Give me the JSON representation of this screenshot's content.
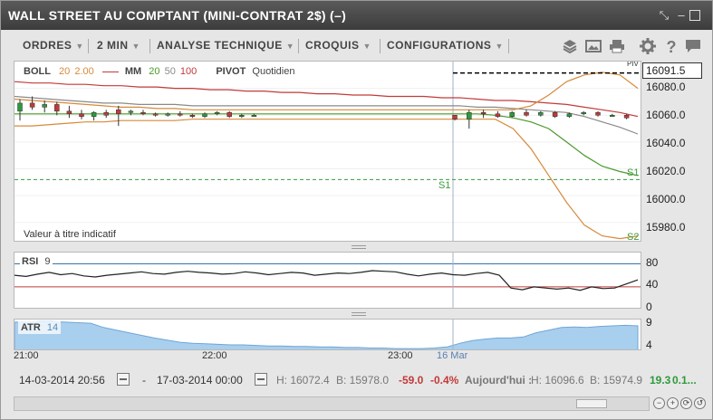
{
  "window": {
    "title": "WALL STREET AU COMPTANT (MINI-CONTRAT 2$) (–)",
    "controls": [
      "collapse-icon",
      "restore-icon",
      "maximize-icon",
      "close-icon"
    ]
  },
  "toolbar": {
    "menus": [
      {
        "label": "ORDRES"
      },
      {
        "label": "2 MIN"
      },
      {
        "label": "ANALYSE TECHNIQUE"
      },
      {
        "label": "CROQUIS"
      },
      {
        "label": "CONFIGURATIONS"
      }
    ],
    "icons": [
      "layers-icon",
      "image-icon",
      "print-icon",
      "gear-icon",
      "help-icon",
      "chat-icon"
    ]
  },
  "main_panel": {
    "legend": {
      "boll_label": "BOLL",
      "boll_p1": "20",
      "boll_p2": "2.00",
      "mm_label": "MM",
      "mm_p1": "20",
      "mm_p2": "50",
      "mm_p3": "100",
      "pivot_label": "PIVOT",
      "pivot_value": "Quotidien"
    },
    "indicative_note": "Valeur à titre indicatif",
    "current_price": "16091.5",
    "price_tag_marker": "PIV",
    "s1_label_left": "S1",
    "s1_label_right": "S1",
    "s2_label": "S2"
  },
  "rsi_panel": {
    "label": "RSI",
    "period": "9"
  },
  "atr_panel": {
    "label": "ATR",
    "period": "14"
  },
  "colors": {
    "boll": "#d7893a",
    "mm20": "#4a9a2a",
    "mm50": "#8a8a8a",
    "mm100": "#c23a3a",
    "up": "#2e9a3c",
    "down": "#c23a3a",
    "atr_fill": "#a9cfee",
    "pivot": "#3a9a3a"
  },
  "chart_data": [
    {
      "type": "line",
      "title": "WALL STREET AU COMPTANT (MINI-CONTRAT 2$)",
      "ylim": [
        15965,
        16100
      ],
      "yticks": [
        15980,
        16000,
        16020,
        16040,
        16060,
        16080
      ],
      "xticks": [
        "21:00",
        "22:00",
        "23:00",
        "16 Mar"
      ],
      "current_value": 16091.5,
      "pivot_lines": [
        {
          "name": "S1",
          "value": 16012
        },
        {
          "name": "S2",
          "value": 15963
        }
      ],
      "candles": [
        {
          "o": 16063,
          "h": 16072,
          "l": 16056,
          "c": 16069
        },
        {
          "o": 16069,
          "h": 16074,
          "l": 16064,
          "c": 16066
        },
        {
          "o": 16066,
          "h": 16071,
          "l": 16062,
          "c": 16068
        },
        {
          "o": 16068,
          "h": 16070,
          "l": 16060,
          "c": 16063
        },
        {
          "o": 16063,
          "h": 16067,
          "l": 16058,
          "c": 16061
        },
        {
          "o": 16061,
          "h": 16064,
          "l": 16057,
          "c": 16059
        },
        {
          "o": 16059,
          "h": 16063,
          "l": 16056,
          "c": 16062
        },
        {
          "o": 16062,
          "h": 16064,
          "l": 16058,
          "c": 16060
        },
        {
          "o": 16064,
          "h": 16067,
          "l": 16052,
          "c": 16061
        },
        {
          "o": 16062,
          "h": 16064,
          "l": 16060,
          "c": 16063
        },
        {
          "o": 16062,
          "h": 16064,
          "l": 16060,
          "c": 16061
        },
        {
          "o": 16061,
          "h": 16062,
          "l": 16059,
          "c": 16060
        },
        {
          "o": 16060,
          "h": 16062,
          "l": 16059,
          "c": 16061
        },
        {
          "o": 16061,
          "h": 16063,
          "l": 16059,
          "c": 16060
        },
        {
          "o": 16060,
          "h": 16061,
          "l": 16058,
          "c": 16059
        },
        {
          "o": 16059,
          "h": 16062,
          "l": 16058,
          "c": 16061
        },
        {
          "o": 16061,
          "h": 16063,
          "l": 16060,
          "c": 16062
        },
        {
          "o": 16062,
          "h": 16063,
          "l": 16058,
          "c": 16059
        },
        {
          "o": 16059,
          "h": 16061,
          "l": 16058,
          "c": 16060
        },
        {
          "o": 16060,
          "h": 16061,
          "l": 16059,
          "c": 16060
        },
        {
          "o": 16060,
          "h": 16060,
          "l": 16056,
          "c": 16057
        },
        {
          "o": 16057,
          "h": 16064,
          "l": 16050,
          "c": 16062
        },
        {
          "o": 16062,
          "h": 16064,
          "l": 16058,
          "c": 16061
        },
        {
          "o": 16061,
          "h": 16063,
          "l": 16058,
          "c": 16059
        },
        {
          "o": 16059,
          "h": 16063,
          "l": 16058,
          "c": 16062
        },
        {
          "o": 16062,
          "h": 16064,
          "l": 16059,
          "c": 16060
        },
        {
          "o": 16060,
          "h": 16063,
          "l": 16059,
          "c": 16062
        },
        {
          "o": 16062,
          "h": 16063,
          "l": 16058,
          "c": 16059
        },
        {
          "o": 16059,
          "h": 16062,
          "l": 16058,
          "c": 16061
        },
        {
          "o": 16061,
          "h": 16063,
          "l": 16060,
          "c": 16062
        },
        {
          "o": 16062,
          "h": 16063,
          "l": 16059,
          "c": 16060
        },
        {
          "o": 16060,
          "h": 16061,
          "l": 16059,
          "c": 16060
        },
        {
          "o": 16060,
          "h": 16061,
          "l": 16057,
          "c": 16058
        }
      ],
      "ma20": [
        16061,
        16061,
        16061,
        16061,
        16061,
        16061,
        16061,
        16061,
        16061,
        16061,
        16061,
        16061,
        16061,
        16061,
        16061,
        16061,
        16061,
        16061,
        16061,
        16061,
        16061,
        16061,
        16061,
        16061,
        16061,
        16061,
        16061,
        16060,
        16058,
        16055,
        16050,
        16040,
        16030,
        16022,
        16018,
        16015
      ],
      "ma50": [
        16074,
        16073,
        16072,
        16071,
        16070,
        16069,
        16069,
        16068,
        16068,
        16068,
        16067,
        16067,
        16067,
        16067,
        16067,
        16067,
        16067,
        16067,
        16067,
        16067,
        16067,
        16067,
        16067,
        16067,
        16067,
        16067,
        16066,
        16066,
        16065,
        16064,
        16063,
        16062,
        16059,
        16055,
        16051,
        16046
      ],
      "ma100": [
        16085,
        16084,
        16084,
        16083,
        16083,
        16082,
        16082,
        16081,
        16081,
        16080,
        16080,
        16079,
        16079,
        16078,
        16078,
        16077,
        16077,
        16076,
        16076,
        16075,
        16075,
        16074,
        16074,
        16074,
        16073,
        16073,
        16072,
        16071,
        16071,
        16070,
        16069,
        16068,
        16066,
        16064,
        16062,
        16059
      ],
      "boll_upper": [
        16072,
        16071,
        16070,
        16069,
        16068,
        16067,
        16066,
        16066,
        16065,
        16065,
        16064,
        16064,
        16064,
        16064,
        16064,
        16064,
        16064,
        16064,
        16064,
        16064,
        16064,
        16064,
        16064,
        16064,
        16064,
        16064,
        16064,
        16064,
        16064,
        16067,
        16075,
        16085,
        16090,
        16092,
        16090,
        16080
      ],
      "boll_lower": [
        16052,
        16052,
        16053,
        16054,
        16055,
        16055,
        16056,
        16056,
        16056,
        16056,
        16057,
        16057,
        16057,
        16057,
        16057,
        16057,
        16057,
        16057,
        16057,
        16057,
        16057,
        16057,
        16057,
        16057,
        16057,
        16057,
        16057,
        16057,
        16050,
        16035,
        16015,
        15995,
        15978,
        15970,
        15968,
        15970
      ]
    },
    {
      "type": "line",
      "title": "RSI 9",
      "ylim": [
        0,
        80
      ],
      "yticks": [
        0,
        40,
        80
      ],
      "levels": [
        30,
        70
      ],
      "values": [
        50,
        48,
        52,
        55,
        51,
        53,
        49,
        47,
        50,
        52,
        54,
        56,
        53,
        52,
        55,
        57,
        55,
        54,
        52,
        53,
        56,
        54,
        51,
        53,
        55,
        54,
        50,
        52,
        54,
        53,
        55,
        58,
        57,
        56,
        52,
        49,
        52,
        54,
        51,
        50,
        53,
        55,
        50,
        28,
        25,
        30,
        28,
        26,
        28,
        24,
        30,
        27,
        28,
        35,
        42
      ]
    },
    {
      "type": "area",
      "title": "ATR 14",
      "ylim": [
        3.5,
        9.5
      ],
      "yticks": [
        4,
        9
      ],
      "values": [
        9.0,
        9.0,
        9.1,
        9.1,
        9.0,
        8.9,
        8.8,
        8.0,
        7.5,
        7.0,
        6.5,
        6.0,
        5.6,
        5.2,
        5.0,
        4.9,
        4.8,
        4.7,
        4.7,
        4.6,
        4.5,
        4.5,
        4.4,
        4.4,
        4.3,
        4.3,
        4.2,
        4.2,
        4.1,
        4.1,
        4.0,
        4.0,
        4.0,
        4.1,
        4.3,
        5.0,
        5.5,
        5.8,
        6.0,
        6.0,
        6.2,
        7.0,
        7.5,
        8.0,
        8.1,
        8.0,
        8.2,
        8.3,
        8.4,
        8.3
      ]
    }
  ],
  "status": {
    "date_from": "14-03-2014 20:56",
    "dash": "-",
    "date_to": "17-03-2014 00:00",
    "high": "H: 16072.4",
    "low": "B: 15978.0",
    "change": "-59.0",
    "change_pct": "-0.4%",
    "today_label": "Aujourd'hui :",
    "today_high": "H: 16096.6",
    "today_low": "B: 15974.9",
    "today_change": "19.3",
    "today_change_pct": "0.1..."
  },
  "axis": {
    "main_ticks": [
      "16080.0",
      "16060.0",
      "16040.0",
      "16020.0",
      "16000.0",
      "15980.0"
    ],
    "rsi_ticks": [
      "80",
      "40",
      "0"
    ],
    "atr_ticks": [
      "9",
      "4"
    ],
    "time_ticks": [
      "21:00",
      "22:00",
      "23:00",
      "16 Mar"
    ]
  }
}
